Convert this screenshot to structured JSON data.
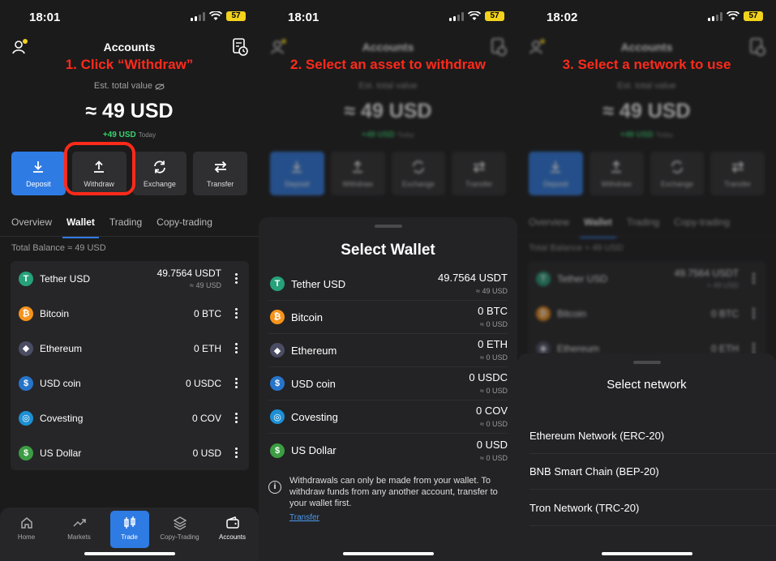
{
  "screens": [
    {
      "time": "18:01",
      "battery": "57",
      "header_title": "Accounts",
      "step_label": "1. Click “Withdraw”",
      "est_label": "Est. total value",
      "total_value": "≈ 49 USD",
      "change": "+49 USD",
      "change_period": "Today",
      "actions": [
        "Deposit",
        "Withdraw",
        "Exchange",
        "Transfer"
      ],
      "tabs": [
        "Overview",
        "Wallet",
        "Trading",
        "Copy-trading"
      ],
      "total_balance": "Total Balance ≈ 49 USD",
      "wallet": [
        {
          "name": "Tether USD",
          "amount": "49.7564 USDT",
          "sub": "≈ 49 USD",
          "icon": "T"
        },
        {
          "name": "Bitcoin",
          "amount": "0 BTC",
          "sub": "",
          "icon": "₿"
        },
        {
          "name": "Ethereum",
          "amount": "0 ETH",
          "sub": "",
          "icon": "◆"
        },
        {
          "name": "USD coin",
          "amount": "0 USDC",
          "sub": "",
          "icon": "$"
        },
        {
          "name": "Covesting",
          "amount": "0 COV",
          "sub": "",
          "icon": "◎"
        },
        {
          "name": "US Dollar",
          "amount": "0 USD",
          "sub": "",
          "icon": "$"
        }
      ],
      "nav": [
        "Home",
        "Markets",
        "Trade",
        "Copy-Trading",
        "Accounts"
      ]
    },
    {
      "time": "18:01",
      "battery": "57",
      "header_title": "Accounts",
      "step_label": "2. Select an asset to withdraw",
      "est_label": "Est. total value",
      "total_value": "≈ 49 USD",
      "change": "+49 USD",
      "change_period": "Today",
      "actions": [
        "Deposit",
        "Withdraw",
        "Exchange",
        "Transfer"
      ],
      "sheet_title": "Select Wallet",
      "wallet": [
        {
          "name": "Tether USD",
          "amount": "49.7564 USDT",
          "sub": "≈ 49 USD"
        },
        {
          "name": "Bitcoin",
          "amount": "0 BTC",
          "sub": "≈ 0 USD"
        },
        {
          "name": "Ethereum",
          "amount": "0 ETH",
          "sub": "≈ 0 USD"
        },
        {
          "name": "USD coin",
          "amount": "0 USDC",
          "sub": "≈ 0 USD"
        },
        {
          "name": "Covesting",
          "amount": "0 COV",
          "sub": "≈ 0 USD"
        },
        {
          "name": "US Dollar",
          "amount": "0 USD",
          "sub": "≈ 0 USD"
        }
      ],
      "info_text": "Withdrawals can only be made from your wallet. To withdraw funds from any another account, transfer to your wallet first.",
      "info_link": "Transfer"
    },
    {
      "time": "18:02",
      "battery": "57",
      "header_title": "Accounts",
      "step_label": "3. Select a network to use",
      "est_label": "Est. total value",
      "total_value": "≈ 49 USD",
      "change": "+49 USD",
      "change_period": "Today",
      "actions": [
        "Deposit",
        "Withdraw",
        "Exchange",
        "Transfer"
      ],
      "tabs": [
        "Overview",
        "Wallet",
        "Trading",
        "Copy-trading"
      ],
      "total_balance": "Total Balance ≈ 49 USD",
      "wallet": [
        {
          "name": "Tether USD",
          "amount": "49.7564 USDT",
          "sub": "≈ 49 USD"
        },
        {
          "name": "Bitcoin",
          "amount": "0 BTC",
          "sub": ""
        },
        {
          "name": "Ethereum",
          "amount": "0 ETH",
          "sub": ""
        }
      ],
      "sheet_title": "Select network",
      "networks": [
        "Ethereum Network (ERC-20)",
        "BNB Smart Chain (BEP-20)",
        "Tron Network (TRC-20)"
      ]
    }
  ],
  "colors": {
    "accent": "#2e7be4",
    "annotation": "#ff2a1a",
    "positive": "#36d36b",
    "battery": "#f2d21c"
  }
}
